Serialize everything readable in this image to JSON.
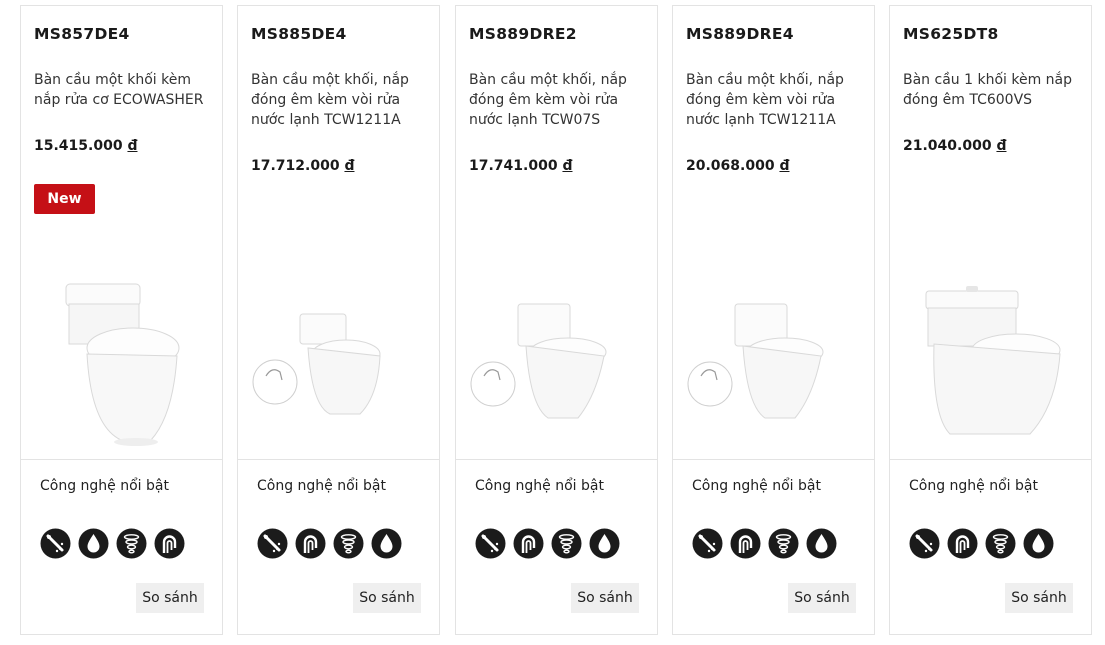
{
  "products": [
    {
      "code": "MS857DE4",
      "desc": "Bàn cầu một khối kèm nắp rửa cơ ECOWASHER",
      "price": "15.415.000",
      "currency": "đ",
      "badge": "New",
      "features_title": "Công nghệ nổi bật",
      "features": [
        "nozzle-icon",
        "water-drop-icon",
        "swirl-flush-icon",
        "faucet-icon"
      ],
      "compare": "So sánh"
    },
    {
      "code": "MS885DE4",
      "desc": "Bàn cầu một khối, nắp đóng êm kèm vòi rửa nước lạnh TCW1211A",
      "price": "17.712.000",
      "currency": "đ",
      "features_title": "Công nghệ nổi bật",
      "features": [
        "nozzle-icon",
        "faucet-icon",
        "swirl-flush-icon",
        "water-drop-icon"
      ],
      "compare": "So sánh"
    },
    {
      "code": "MS889DRE2",
      "desc": "Bàn cầu một khối, nắp đóng êm kèm vòi rửa nước lạnh TCW07S",
      "price": "17.741.000",
      "currency": "đ",
      "features_title": "Công nghệ nổi bật",
      "features": [
        "nozzle-icon",
        "faucet-icon",
        "swirl-flush-icon",
        "water-drop-icon"
      ],
      "compare": "So sánh"
    },
    {
      "code": "MS889DRE4",
      "desc": "Bàn cầu một khối, nắp đóng êm kèm vòi rửa nước lạnh TCW1211A",
      "price": "20.068.000",
      "currency": "đ",
      "features_title": "Công nghệ nổi bật",
      "features": [
        "nozzle-icon",
        "faucet-icon",
        "swirl-flush-icon",
        "water-drop-icon"
      ],
      "compare": "So sánh"
    },
    {
      "code": "MS625DT8",
      "desc": "Bàn cầu 1 khối kèm nắp đóng êm TC600VS",
      "price": "21.040.000",
      "currency": "đ",
      "features_title": "Công nghệ nổi bật",
      "features": [
        "nozzle-icon",
        "faucet-icon",
        "swirl-flush-icon",
        "water-drop-icon"
      ],
      "compare": "So sánh"
    }
  ],
  "colors": {
    "badge": "#c51016",
    "icon": "#1b1b1b",
    "compare_bg": "#efefef"
  }
}
